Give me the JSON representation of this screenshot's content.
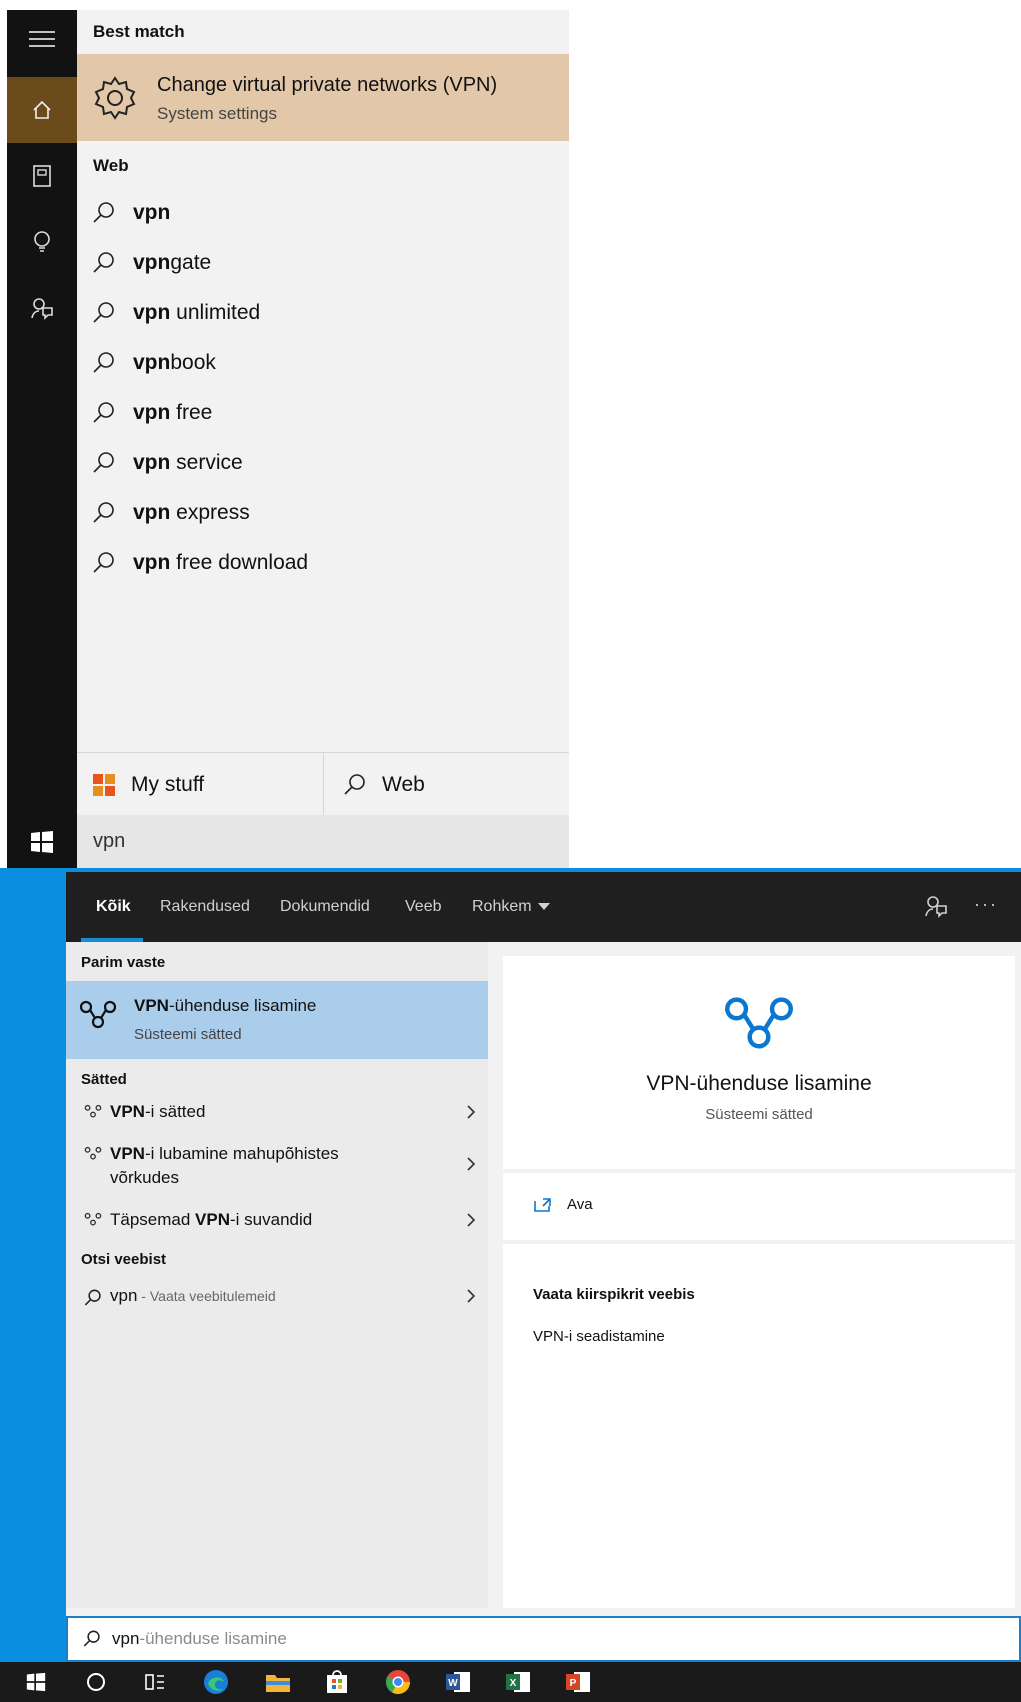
{
  "cortana": {
    "best_match_header": "Best match",
    "best_match": {
      "title": "Change virtual private networks (VPN)",
      "subtitle": "System settings"
    },
    "web_header": "Web",
    "web_results": [
      {
        "bold": "vpn",
        "rest": ""
      },
      {
        "bold": "vpn",
        "rest": "gate"
      },
      {
        "bold": "vpn",
        "rest": " unlimited"
      },
      {
        "bold": "vpn",
        "rest": "book"
      },
      {
        "bold": "vpn",
        "rest": " free"
      },
      {
        "bold": "vpn",
        "rest": " service"
      },
      {
        "bold": "vpn",
        "rest": " express"
      },
      {
        "bold": "vpn",
        "rest": " free download"
      }
    ],
    "scope_my_stuff": "My stuff",
    "scope_web": "Web",
    "query": "vpn",
    "rail_icons": [
      "hamburger-icon",
      "home-icon",
      "notebook-icon",
      "lightbulb-icon",
      "feedback-icon",
      "windows-icon"
    ]
  },
  "win_search": {
    "tabs": [
      {
        "label": "Kõik",
        "active": true
      },
      {
        "label": "Rakendused"
      },
      {
        "label": "Dokumendid"
      },
      {
        "label": "Veeb"
      },
      {
        "label": "Rohkem"
      }
    ],
    "best_header": "Parim vaste",
    "best": {
      "title_bold": "VPN",
      "title_rest": "-ühenduse lisamine",
      "subtitle": "Süsteemi sätted"
    },
    "settings_header": "Sätted",
    "settings": [
      {
        "pre": "",
        "bold": "VPN",
        "post": "-i sätted"
      },
      {
        "pre": "",
        "bold": "VPN",
        "post": "-i lubamine mahupõhistes võrkudes"
      },
      {
        "pre": "Täpsemad ",
        "bold": "VPN",
        "post": "-i suvandid"
      }
    ],
    "web_header": "Otsi veebist",
    "web_item": {
      "query": "vpn",
      "hint": " - Vaata veebitulemeid"
    },
    "detail": {
      "title": "VPN-ühenduse lisamine",
      "subtitle": "Süsteemi sätted",
      "open_label": "Ava",
      "quick_header": "Vaata kiirspikrit veebis",
      "quick_link": "VPN-i seadistamine"
    },
    "search_typed": "vpn",
    "search_completion": "-ühenduse lisamine",
    "accent_color": "#0a8fe0",
    "highlight_color": "#a9cdeb"
  },
  "taskbar": {
    "icons": [
      "start-icon",
      "cortana-icon",
      "task-view-icon",
      "edge-icon",
      "file-explorer-icon",
      "store-icon",
      "chrome-icon",
      "word-icon",
      "excel-icon",
      "powerpoint-icon"
    ]
  }
}
